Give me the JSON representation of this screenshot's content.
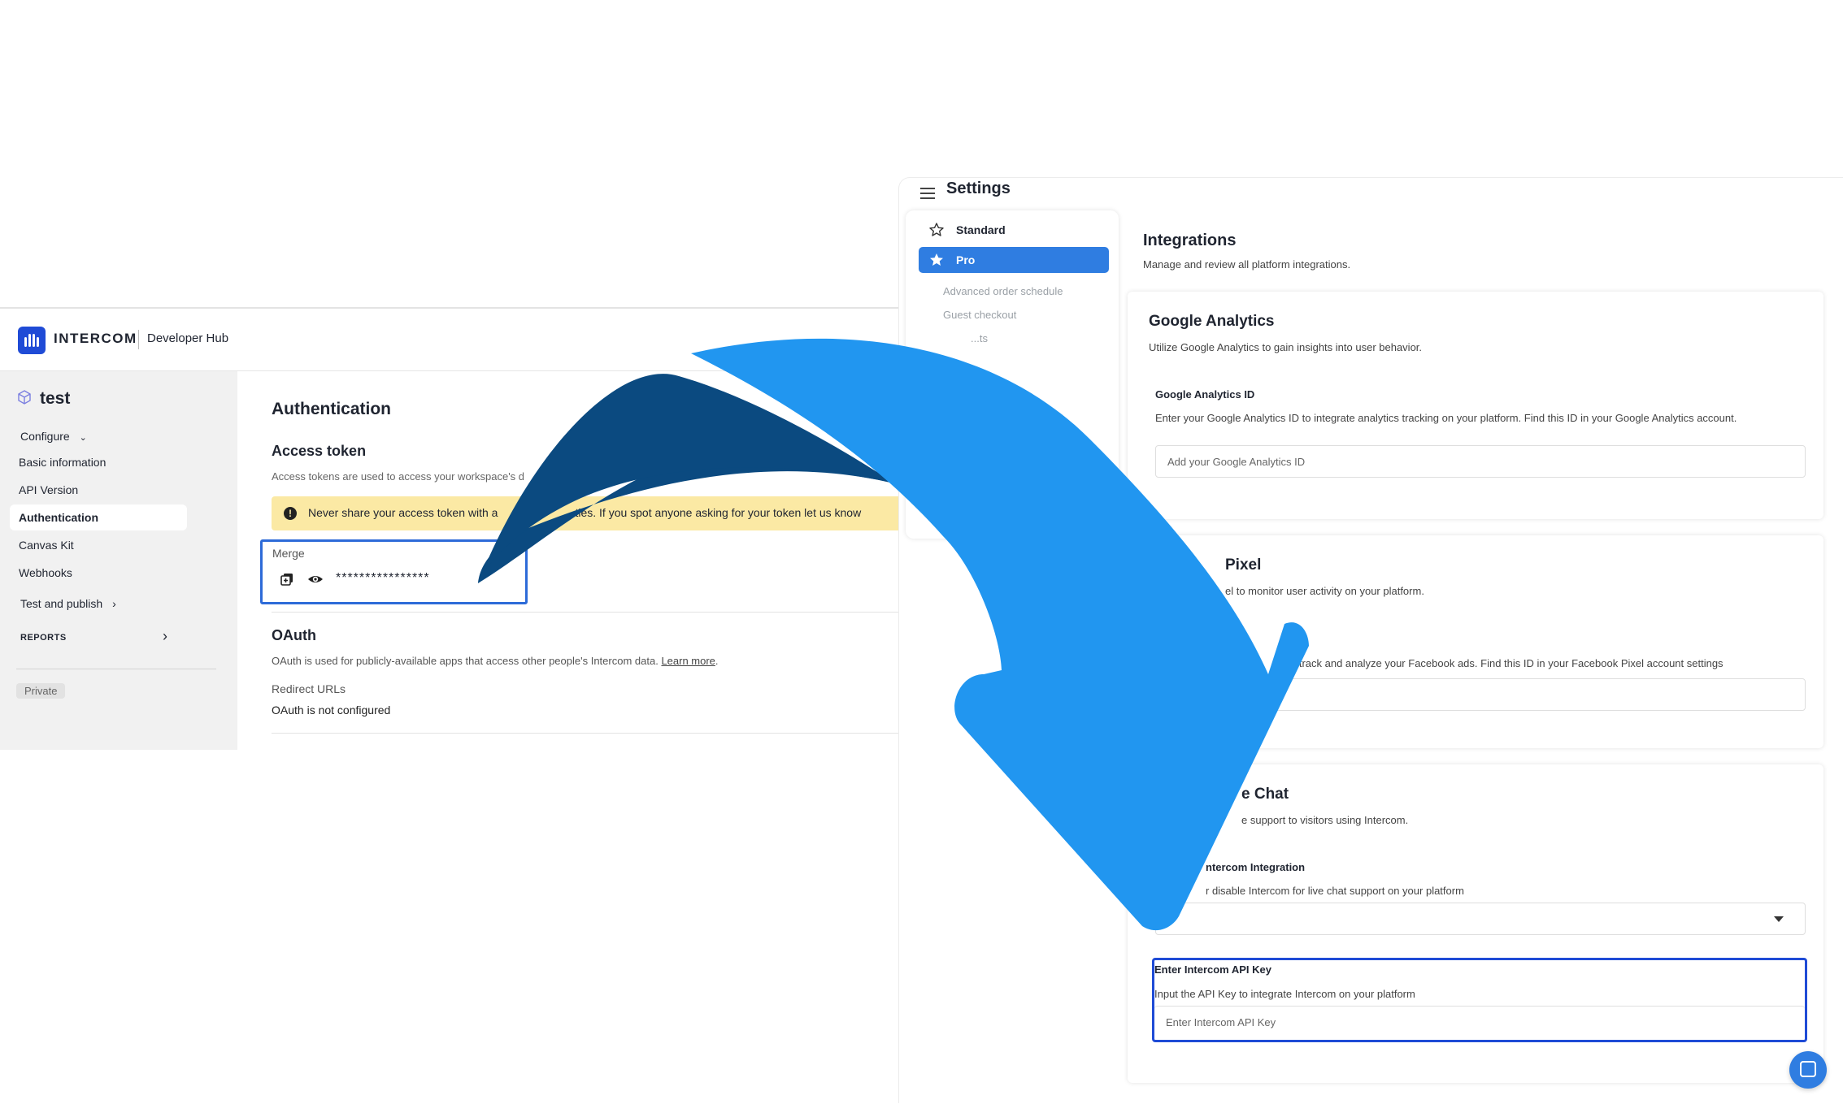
{
  "intercom": {
    "brand": "INTERCOM",
    "hub": "Developer Hub",
    "app_name": "test",
    "configure": "Configure",
    "nav": [
      "Basic information",
      "API Version",
      "Authentication",
      "Canvas Kit",
      "Webhooks"
    ],
    "test_publish": "Test and publish",
    "reports": "REPORTS",
    "private_badge": "Private",
    "page_title": "Authentication",
    "access_token_title": "Access token",
    "access_token_desc": "Access tokens are used to access your workspace's d",
    "warning": "Never share your access token with a",
    "warning_rest": "ties. If you spot anyone asking for your token let us know",
    "token_label": "Merge",
    "token_value": "****************",
    "oauth_title": "OAuth",
    "oauth_desc": "OAuth is used for publicly-available apps that access other people's Intercom data.",
    "oauth_link": "Learn more",
    "redirect_label": "Redirect URLs",
    "redirect_value": "OAuth is not configured"
  },
  "settings": {
    "title": "Settings",
    "side_items": [
      "Standard",
      "Pro"
    ],
    "sub_items": [
      "Advanced order schedule",
      "Guest checkout",
      "...ts"
    ],
    "integrations_title": "Integrations",
    "integrations_desc": "Manage and review all platform integrations.",
    "ga": {
      "title": "Google Analytics",
      "desc": "Utilize Google Analytics to gain insights into user behavior.",
      "field_label": "Google Analytics ID",
      "field_help": "Enter your Google Analytics ID to integrate analytics tracking on your platform. Find this ID in your Google Analytics account.",
      "placeholder": "Add your Google Analytics ID"
    },
    "fb": {
      "title": "Pixel",
      "desc": "el to monitor user activity on your platform.",
      "field_help": "o track and analyze your Facebook ads. Find this ID in your Facebook Pixel account settings"
    },
    "chat": {
      "title": "e Chat",
      "desc": "e support to visitors using Intercom.",
      "toggle_label": "ntercom Integration",
      "toggle_help": "r disable Intercom for live chat support on your platform",
      "api_label": "Enter Intercom API Key",
      "api_help": "Input the API Key to integrate Intercom on your platform",
      "api_placeholder": "Enter Intercom API Key"
    }
  },
  "colors": {
    "arrow_dark": "#0b4a80",
    "arrow_light": "#2196f0",
    "accent": "#2f7de1",
    "warning_bg": "#fbe9a4"
  }
}
